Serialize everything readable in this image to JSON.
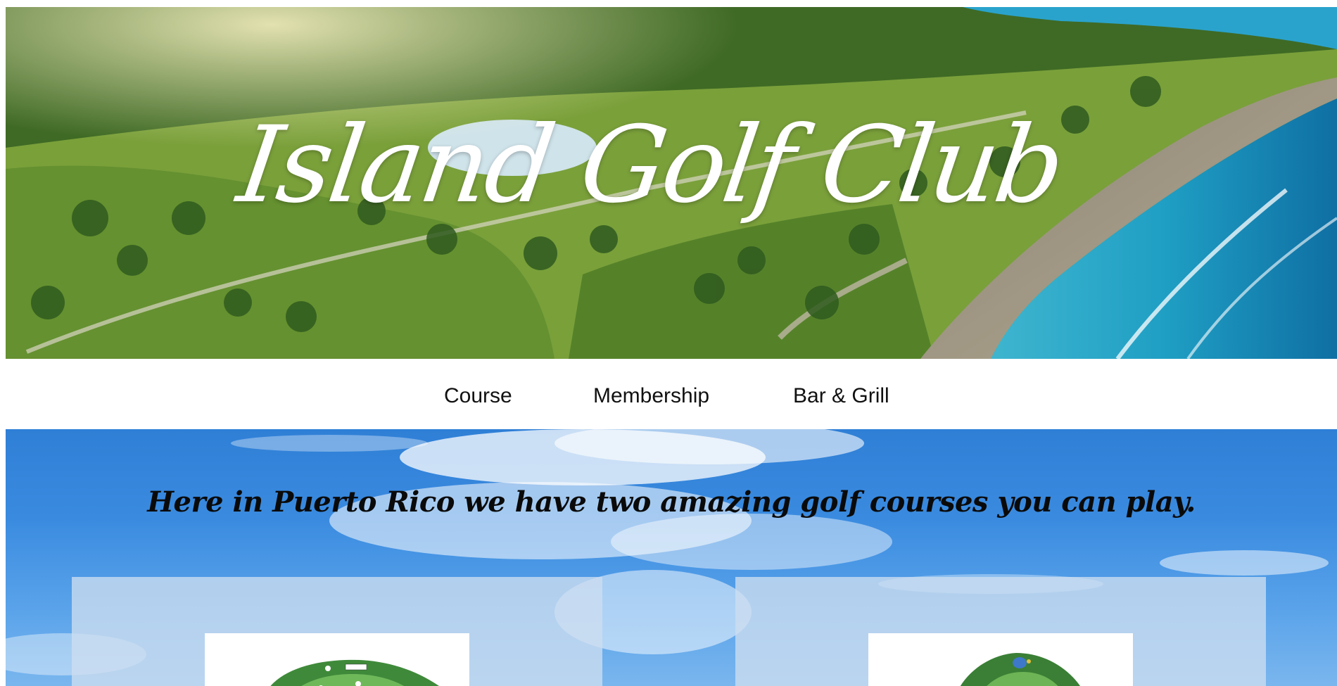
{
  "hero": {
    "title": "Island Golf Club"
  },
  "nav": {
    "items": [
      {
        "label": "Course"
      },
      {
        "label": "Membership"
      },
      {
        "label": "Bar & Grill"
      }
    ]
  },
  "section": {
    "tagline": "Here in Puerto Rico we have two amazing golf courses you can play."
  },
  "cards": [
    {
      "image": "course-map-1"
    },
    {
      "image": "course-map-2"
    }
  ],
  "colors": {
    "nav_text": "#111111",
    "tagline_text": "#0a0a0a",
    "sky_blue": "#2f7fd6",
    "ocean": "#1f9fc4",
    "grass": "#7fa03f"
  }
}
